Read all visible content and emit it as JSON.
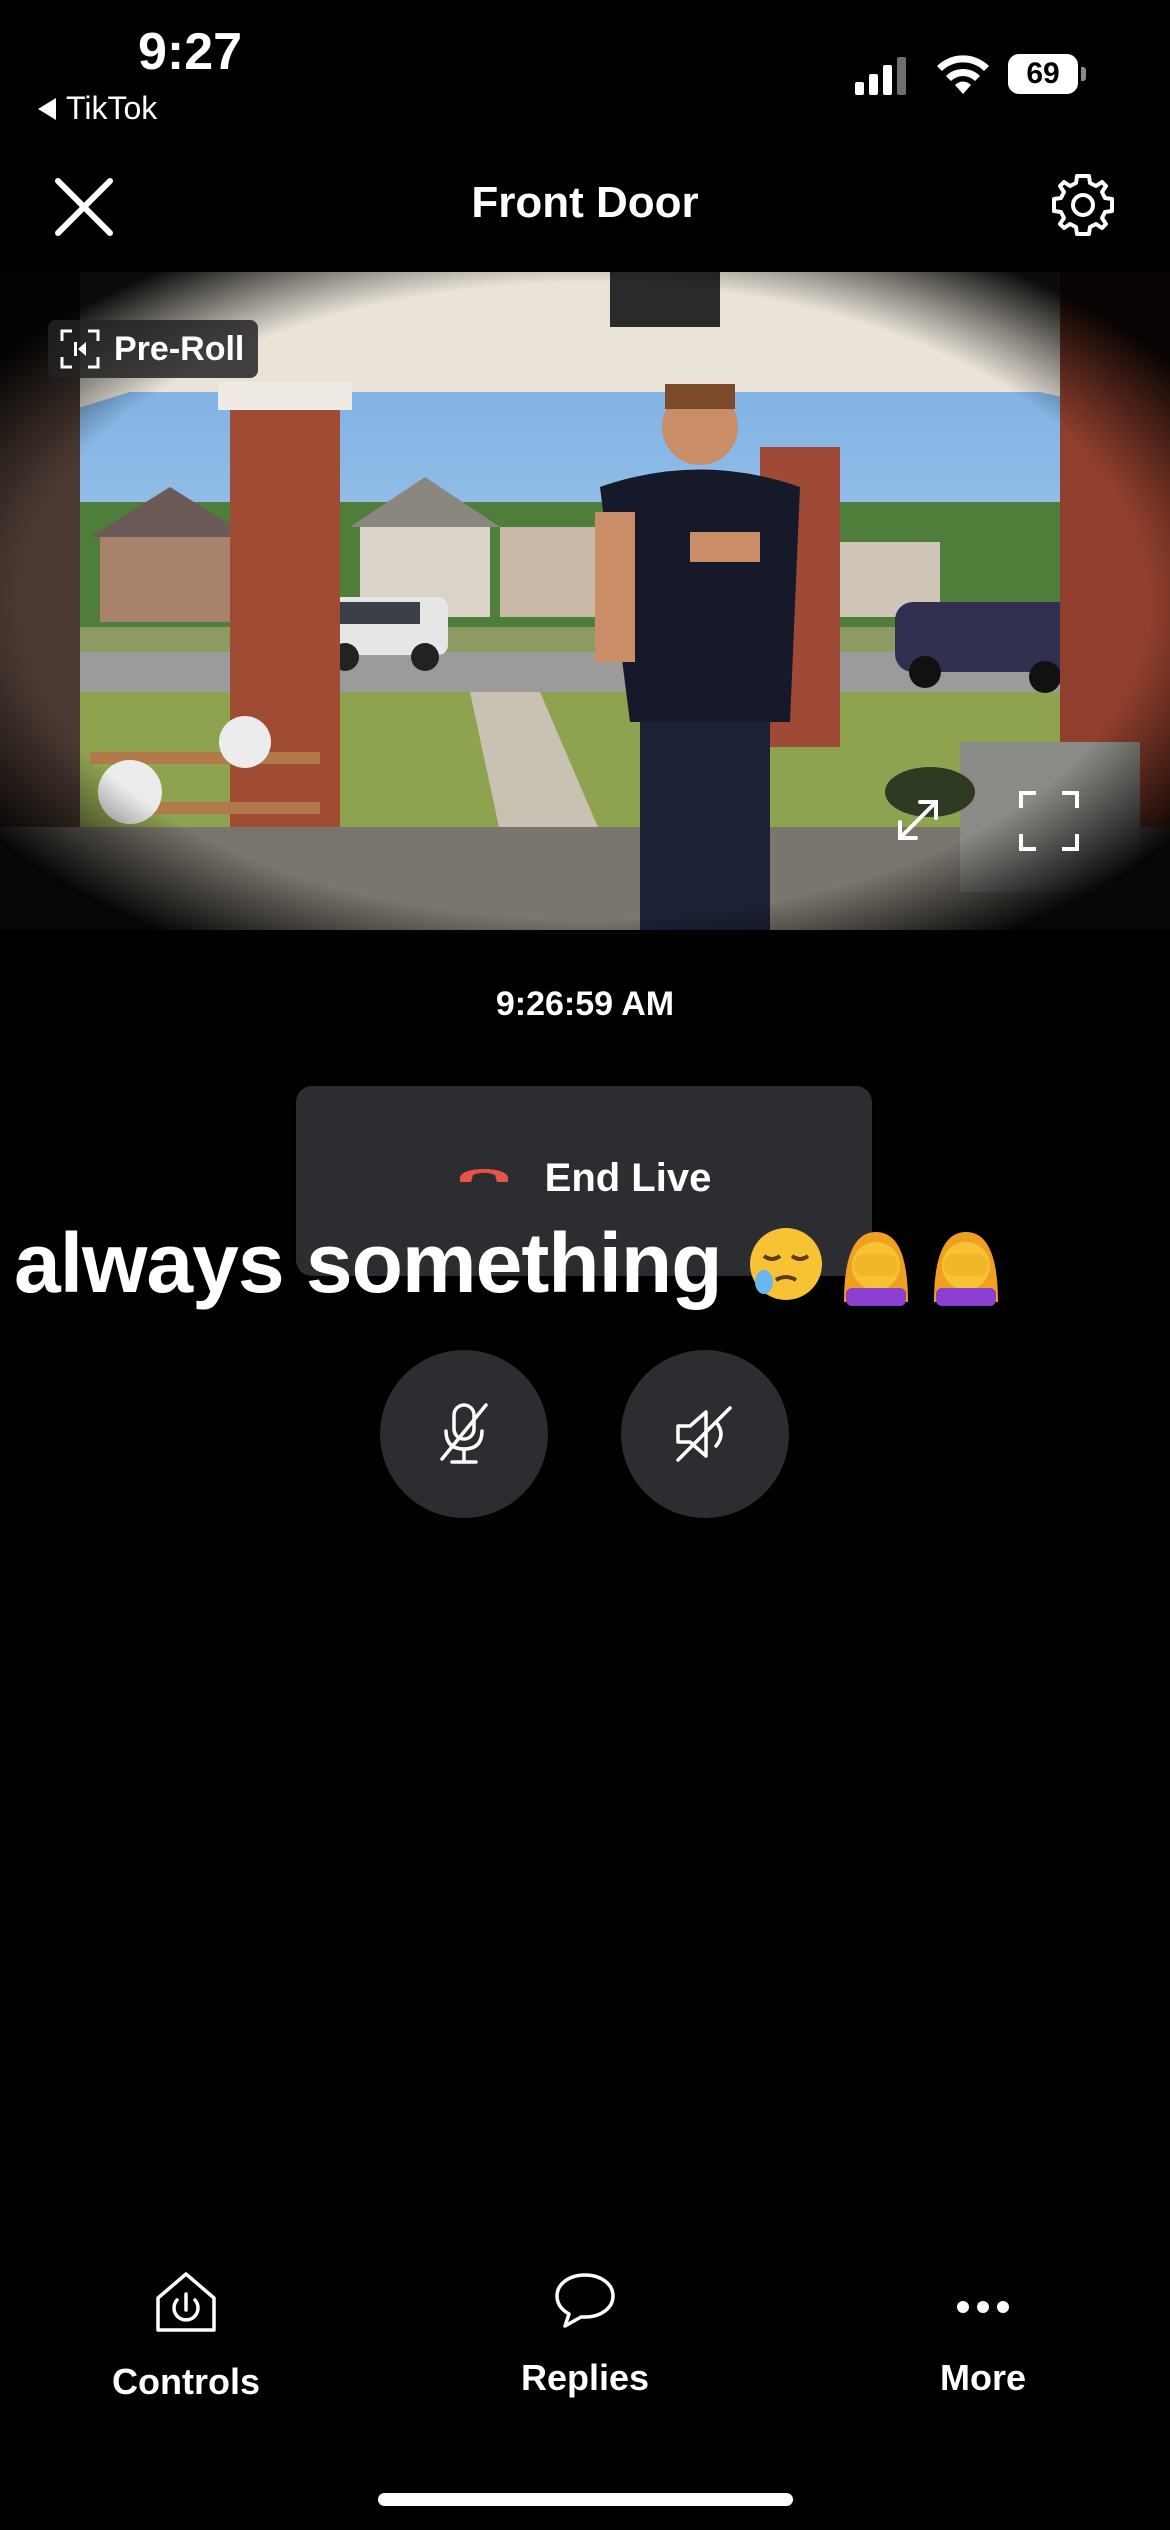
{
  "status_bar": {
    "time": "9:27",
    "back_app": "TikTok",
    "battery": "69"
  },
  "header": {
    "title": "Front Door"
  },
  "feed": {
    "preroll_label": "Pre-Roll"
  },
  "timestamp": "9:26:59 AM",
  "end_live": {
    "label": "End Live",
    "icon_color": "#e5534b"
  },
  "caption": {
    "text": "always something",
    "emojis": [
      "sleepy-face",
      "woman-facepalming",
      "woman-facepalming"
    ]
  },
  "controls": {
    "mic": "microphone-muted-icon",
    "speaker": "speaker-muted-icon"
  },
  "bottom_nav": [
    {
      "label": "Controls",
      "icon": "power-house-icon"
    },
    {
      "label": "Replies",
      "icon": "speech-bubble-icon"
    },
    {
      "label": "More",
      "icon": "more-dots-icon"
    }
  ]
}
